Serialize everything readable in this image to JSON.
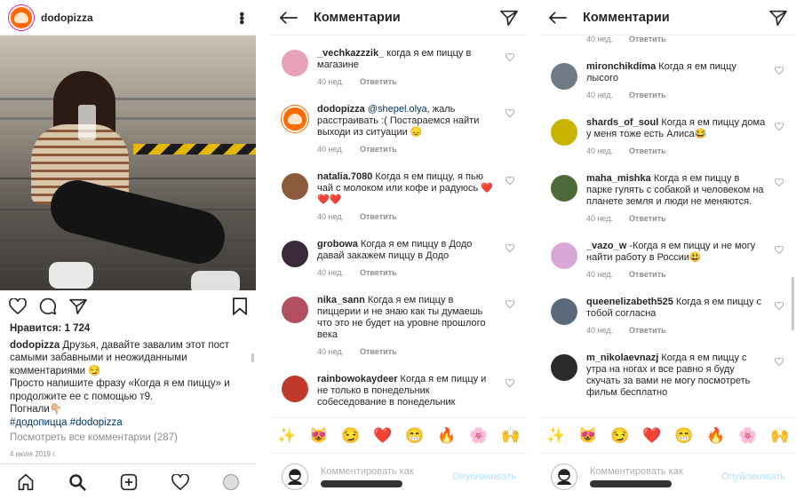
{
  "post": {
    "username": "dodopizza",
    "likes": "Нравится: 1 724",
    "caption_user": "dodopizza",
    "caption_line1": " Друзья, давайте завалим этот пост самыми забавными и неожиданными комментариями 😏",
    "caption_line2": "Просто напишите фразу «Когда я ем пиццу» и продолжите ее с помощью т9.",
    "caption_line3": "Погнали👇🏼",
    "hashtags": "#додопицца #dodopizza",
    "view_all": "Посмотреть все комментарии (287)",
    "date": "4 июля 2019 г."
  },
  "comments_screen": {
    "title": "Комментарии",
    "placeholder": "Комментировать как",
    "publish": "Опубликовать",
    "reply": "Ответить",
    "emoji": [
      "✨",
      "😻",
      "😏",
      "❤️",
      "😁",
      "🔥",
      "🌸",
      "🙌"
    ]
  },
  "panel2": {
    "comments": [
      {
        "user": "_vechkazzzik_",
        "text": " когда я ем пиццу в магазине",
        "time": "40 нед."
      },
      {
        "user": "dodopizza",
        "mention": " @shepel.olya",
        "text": ", жаль расстраивать :( Постараемся найти выходи из ситуации 😞",
        "time": "40 нед."
      },
      {
        "user": "natalia.7080",
        "text": " Когда я ем пиццу, я пью чай с молоком или кофе и радуюсь ❤️❤️❤️",
        "time": "40 нед."
      },
      {
        "user": "grobowa",
        "text": " Когда я ем пиццу в Додо давай закажем пиццу в Додо",
        "time": "40 нед."
      },
      {
        "user": "nika_sann",
        "text": " Когда я ем пиццу в пиццерии и не знаю как ты думаешь что это не будет на уровне прошлого века",
        "time": "40 нед."
      },
      {
        "user": "rainbowokaydeer",
        "text": " Когда я ем пиццу и не только в понедельник собеседование в понедельник",
        "time": ""
      }
    ]
  },
  "panel3": {
    "top_time": "40 нед.",
    "comments": [
      {
        "user": "mironchikdima",
        "text": " Когда я ем пиццу лысого",
        "time": "40 нед."
      },
      {
        "user": "shards_of_soul",
        "text": " Когда я ем пиццу дома у меня тоже есть Алиса😂",
        "time": "40 нед."
      },
      {
        "user": "maha_mishka",
        "text": " Когда я ем пиццу в парке гулять с собакой и человеком на планете земля и люди не меняются.",
        "time": "40 нед."
      },
      {
        "user": "_vazo_w",
        "text": " -Когда я ем пиццу и не могу найти работу в России😃",
        "time": "40 нед."
      },
      {
        "user": "queenelizabeth525",
        "text": " Когда я ем пиццу с тобой согласна",
        "time": "40 нед."
      },
      {
        "user": "m_nikolaevnazj",
        "text": " Когда я ем пиццу с утра на ногах и все равно я буду скучать за вами не могу посмотреть фильм бесплатно",
        "time": ""
      }
    ]
  }
}
